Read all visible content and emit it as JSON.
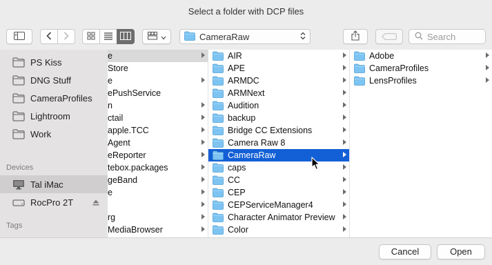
{
  "window": {
    "title": "Select a folder with DCP files"
  },
  "toolbar": {
    "path_label": "CameraRaw",
    "search_placeholder": "Search"
  },
  "sidebar": {
    "favorites": [
      {
        "label": "PS Kiss"
      },
      {
        "label": "DNG Stuff"
      },
      {
        "label": "CameraProfiles"
      },
      {
        "label": "Lightroom"
      },
      {
        "label": "Work"
      }
    ],
    "devices_header": "Devices",
    "devices": [
      {
        "label": "Tal iMac",
        "selected": true
      },
      {
        "label": "RocPro 2T",
        "eject": true
      }
    ],
    "tags_header": "Tags"
  },
  "column1": {
    "items": [
      {
        "label": "e",
        "arrow": true
      },
      {
        "label": "Store",
        "arrow": false
      },
      {
        "label": "e",
        "arrow": true
      },
      {
        "label": "ePushService",
        "arrow": false
      },
      {
        "label": "n",
        "arrow": true
      },
      {
        "label": "ctail",
        "arrow": true
      },
      {
        "label": "apple.TCC",
        "arrow": true
      },
      {
        "label": "Agent",
        "arrow": true
      },
      {
        "label": "eReporter",
        "arrow": true
      },
      {
        "label": "tebox.packages",
        "arrow": true
      },
      {
        "label": "geBand",
        "arrow": true
      },
      {
        "label": "e",
        "arrow": true
      },
      {
        "label": "",
        "arrow": true
      },
      {
        "label": "rg",
        "arrow": true
      },
      {
        "label": "MediaBrowser",
        "arrow": true
      }
    ]
  },
  "column2": {
    "items": [
      {
        "label": "AIR"
      },
      {
        "label": "APE"
      },
      {
        "label": "ARMDC"
      },
      {
        "label": "ARMNext"
      },
      {
        "label": "Audition"
      },
      {
        "label": "backup"
      },
      {
        "label": "Bridge CC Extensions"
      },
      {
        "label": "Camera Raw 8"
      },
      {
        "label": "CameraRaw",
        "selected": true
      },
      {
        "label": "caps"
      },
      {
        "label": "CC"
      },
      {
        "label": "CEP"
      },
      {
        "label": "CEPServiceManager4"
      },
      {
        "label": "Character Animator Preview"
      },
      {
        "label": "Color"
      }
    ]
  },
  "column3": {
    "items": [
      {
        "label": "Adobe"
      },
      {
        "label": "CameraProfiles"
      },
      {
        "label": "LensProfiles"
      }
    ]
  },
  "footer": {
    "cancel_label": "Cancel",
    "open_label": "Open"
  },
  "colors": {
    "selection": "#1360d6",
    "folder": "#7ec4f2",
    "sidebar_bg": "#e4e2e3",
    "window_bg": "#ececec"
  }
}
